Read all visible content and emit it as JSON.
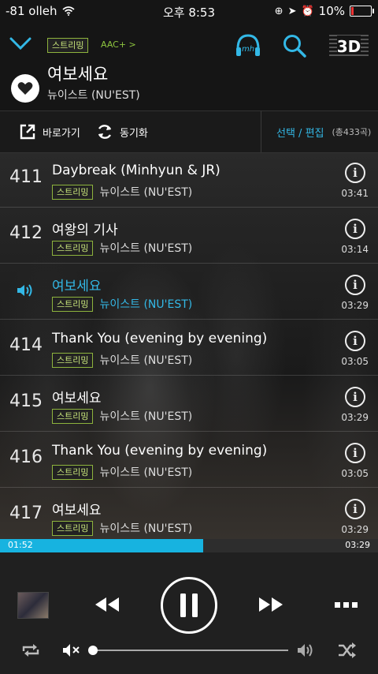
{
  "status_bar": {
    "carrier": "-81 olleh",
    "time": "오후 8:53",
    "battery": "10%"
  },
  "header": {
    "streaming_badge": "스트리밍",
    "codec": "AAC+ >",
    "mh_label": "mh",
    "btn_3d": "3D",
    "now_title": "여보세요",
    "now_artist": "뉴이스트 (NU'EST)"
  },
  "toolbar": {
    "goto_label": "바로가기",
    "sync_label": "동기화",
    "select_edit_label": "선택 / 편집",
    "total_count": "(총433곡)"
  },
  "tracks": [
    {
      "num": "411",
      "title": "Daybreak (Minhyun & JR)",
      "badge": "스트리밍",
      "artist": "뉴이스트 (NU'EST)",
      "duration": "03:41",
      "playing": false
    },
    {
      "num": "412",
      "title": "여왕의 기사",
      "badge": "스트리밍",
      "artist": "뉴이스트 (NU'EST)",
      "duration": "03:14",
      "playing": false
    },
    {
      "num": "",
      "title": "여보세요",
      "badge": "스트리밍",
      "artist": "뉴이스트 (NU'EST)",
      "duration": "03:29",
      "playing": true
    },
    {
      "num": "414",
      "title": "Thank You (evening by evening)",
      "badge": "스트리밍",
      "artist": "뉴이스트 (NU'EST)",
      "duration": "03:05",
      "playing": false
    },
    {
      "num": "415",
      "title": "여보세요",
      "badge": "스트리밍",
      "artist": "뉴이스트 (NU'EST)",
      "duration": "03:29",
      "playing": false
    },
    {
      "num": "416",
      "title": "Thank You (evening by evening)",
      "badge": "스트리밍",
      "artist": "뉴이스트 (NU'EST)",
      "duration": "03:05",
      "playing": false
    },
    {
      "num": "417",
      "title": "여보세요",
      "badge": "스트리밍",
      "artist": "뉴이스트 (NU'EST)",
      "duration": "03:29",
      "playing": false
    }
  ],
  "player": {
    "elapsed": "01:52",
    "total": "03:29",
    "progress_fraction": 0.538,
    "volume_fraction": 0.0,
    "accent_color": "#17b3e0"
  }
}
